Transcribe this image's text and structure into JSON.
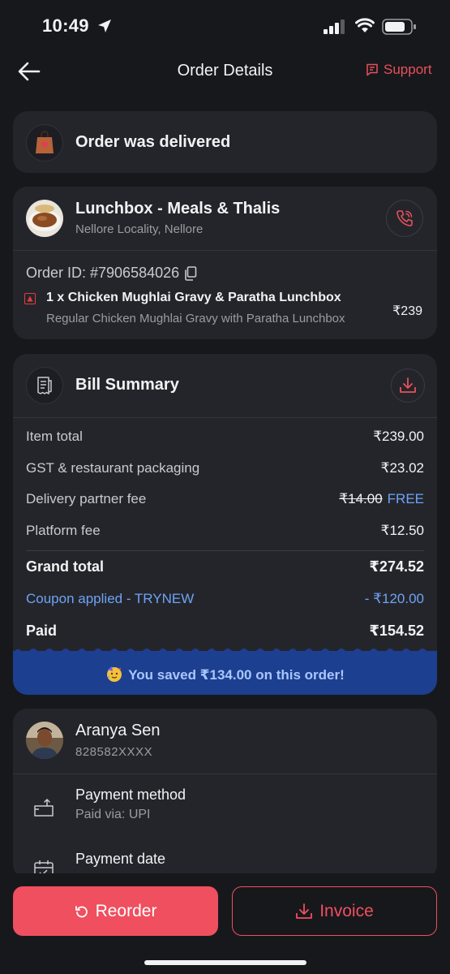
{
  "status_bar": {
    "time": "10:49"
  },
  "nav": {
    "title": "Order Details",
    "support_label": "Support"
  },
  "order_status": {
    "text": "Order was delivered"
  },
  "restaurant": {
    "name": "Lunchbox - Meals & Thalis",
    "location": "Nellore Locality, Nellore",
    "order_id": "Order ID: #7906584026",
    "item": {
      "name": "1 x Chicken Mughlai Gravy & Paratha Lunchbox",
      "description": "Regular Chicken Mughlai Gravy with Paratha Lunchbox",
      "price": "₹239"
    }
  },
  "bill": {
    "title": "Bill Summary",
    "rows": [
      {
        "label": "Item total",
        "value": "₹239.00"
      },
      {
        "label": "GST & restaurant packaging",
        "value": "₹23.02"
      },
      {
        "label": "Delivery partner fee",
        "original": "₹14.00",
        "value": "FREE"
      },
      {
        "label": "Platform fee",
        "value": "₹12.50"
      }
    ],
    "grand_total": {
      "label": "Grand total",
      "value": "₹274.52"
    },
    "coupon": {
      "label": "Coupon applied - TRYNEW",
      "value": "- ₹120.00"
    },
    "paid": {
      "label": "Paid",
      "value": "₹154.52"
    },
    "savings_text": "You saved ₹134.00 on this order!"
  },
  "user": {
    "name": "Aranya Sen",
    "phone": "828582XXXX",
    "payment_method_label": "Payment method",
    "payment_method_value": "Paid via: UPI",
    "payment_date_label": "Payment date"
  },
  "actions": {
    "reorder_label": "Reorder",
    "invoice_label": "Invoice"
  },
  "colors": {
    "accent": "#ef4f5f",
    "background": "#17181c",
    "card": "#24252b",
    "link_blue": "#6ea3f5",
    "savings_bg": "#1d3f8f"
  }
}
